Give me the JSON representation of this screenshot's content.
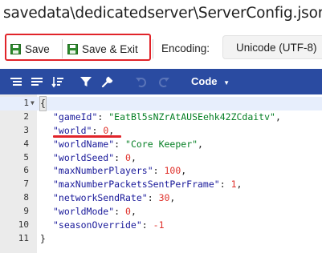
{
  "window": {
    "title": "savedata\\dedicatedserver\\ServerConfig.json"
  },
  "toolbar": {
    "save_label": "Save",
    "save_exit_label": "Save & Exit",
    "encoding_label": "Encoding:",
    "encoding_value": "Unicode (UTF-8)"
  },
  "editor": {
    "mode_label": "Code",
    "icons": [
      "format-icon",
      "compact-icon",
      "sort-icon",
      "filter-icon",
      "repair-icon",
      "undo-icon",
      "redo-icon"
    ]
  },
  "colors": {
    "toolbar_bg": "#2a4ba1",
    "key": "#1a1a9a",
    "string": "#057f24",
    "number": "#e0322c",
    "highlight": "#e1242a"
  },
  "code_lines": [
    {
      "n": "1",
      "brace": "{"
    },
    {
      "n": "2",
      "key": "\"gameId\"",
      "val": "\"EatBl5sNZrAtAUSEehk42ZCdaitv\"",
      "vt": "s"
    },
    {
      "n": "3",
      "key": "\"world\"",
      "val": "0",
      "vt": "n"
    },
    {
      "n": "4",
      "key": "\"worldName\"",
      "val": "\"Core Keeper\"",
      "vt": "s"
    },
    {
      "n": "5",
      "key": "\"worldSeed\"",
      "val": "0",
      "vt": "n"
    },
    {
      "n": "6",
      "key": "\"maxNumberPlayers\"",
      "val": "100",
      "vt": "n"
    },
    {
      "n": "7",
      "key": "\"maxNumberPacketsSentPerFrame\"",
      "val": "1",
      "vt": "n"
    },
    {
      "n": "8",
      "key": "\"networkSendRate\"",
      "val": "30",
      "vt": "n"
    },
    {
      "n": "9",
      "key": "\"worldMode\"",
      "val": "0",
      "vt": "n"
    },
    {
      "n": "10",
      "key": "\"seasonOverride\"",
      "val": "-1",
      "vt": "n",
      "last": true
    },
    {
      "n": "11",
      "brace": "}"
    }
  ]
}
